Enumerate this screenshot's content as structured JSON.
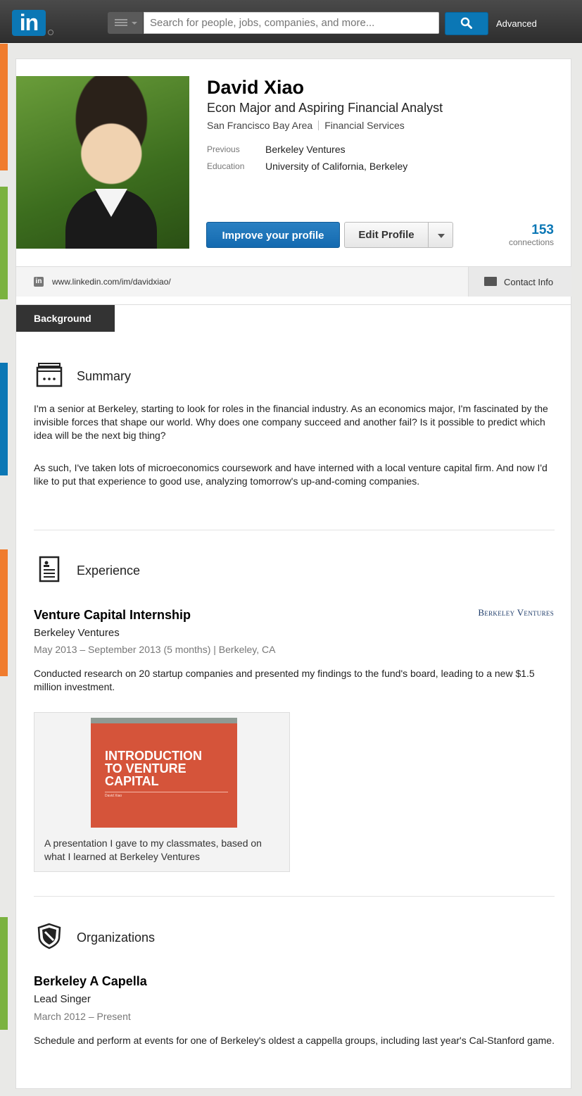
{
  "header": {
    "logo_text": "in",
    "search_placeholder": "Search for people, jobs, companies, and more...",
    "advanced_label": "Advanced"
  },
  "profile": {
    "name": "David Xiao",
    "headline": "Econ Major and Aspiring Financial Analyst",
    "location": "San Francisco Bay Area",
    "industry": "Financial Services",
    "previous_label": "Previous",
    "previous_value": "Berkeley Ventures",
    "education_label": "Education",
    "education_value": "University of California, Berkeley",
    "improve_button": "Improve your profile",
    "edit_button": "Edit Profile",
    "connections_count": "153",
    "connections_label": "connections",
    "url": "www.linkedin.com/im/davidxiao/",
    "contact_info": "Contact Info",
    "small_logo_text": "in"
  },
  "background": {
    "tab_label": "Background",
    "summary": {
      "title": "Summary",
      "p1": "I'm a senior at Berkeley, starting to look for roles in the financial industry. As an economics major, I'm fascinated by the invisible forces that shape our world. Why does one company succeed and another fail? Is it possible to predict which idea will be the next big thing?",
      "p2": "As such, I've taken lots of microeconomics coursework and have interned with a local venture capital firm. And now I'd like to put that experience to good use, analyzing tomorrow's up-and-coming companies."
    },
    "experience": {
      "title": "Experience",
      "job_title": "Venture Capital Internship",
      "company": "Berkeley Ventures",
      "company_logo_text": "Berkeley Ventures",
      "dates": "May 2013 – September 2013 (5 months)  |  Berkeley, CA",
      "description": "Conducted research on 20 startup companies and presented my findings to the fund's board, leading to a new $1.5 million investment.",
      "media_title": "INTRODUCTION TO VENTURE CAPITAL",
      "media_author": "David Xiao",
      "media_caption": "A presentation I gave to my classmates, based on what I learned at Berkeley Ventures"
    },
    "organizations": {
      "title": "Organizations",
      "org_name": "Berkeley A Capella",
      "role": "Lead Singer",
      "dates": "March 2012 – Present",
      "description": "Schedule and perform at events for one of Berkeley's oldest a cappella groups, including last year's Cal-Stanford game."
    }
  },
  "colors": {
    "brand_blue": "#0b77b5",
    "strip_orange": "#f07c2e",
    "strip_green": "#7bb240",
    "strip_blue": "#0b77b5"
  }
}
